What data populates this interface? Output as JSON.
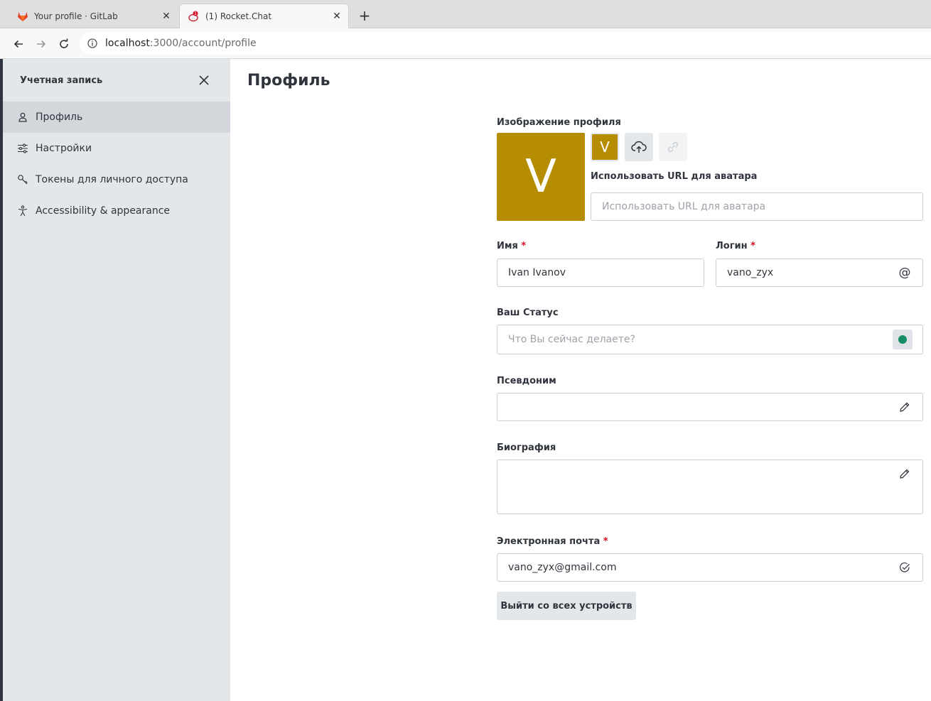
{
  "browser": {
    "tabs": [
      {
        "title": "Your profile · GitLab",
        "active": false,
        "icon": "gitlab-icon"
      },
      {
        "title": "(1) Rocket.Chat",
        "active": true,
        "icon": "rocketchat-icon",
        "badge": "1"
      }
    ],
    "url_host": "localhost",
    "url_path": ":3000/account/profile"
  },
  "sidebar": {
    "title": "Учетная запись",
    "items": [
      {
        "label": "Профиль",
        "icon": "user-icon",
        "active": true
      },
      {
        "label": "Настройки",
        "icon": "sliders-icon",
        "active": false
      },
      {
        "label": "Токены для личного доступа",
        "icon": "key-icon",
        "active": false
      },
      {
        "label": "Accessibility & appearance",
        "icon": "accessibility-icon",
        "active": false
      }
    ]
  },
  "main": {
    "title": "Профиль",
    "avatar": {
      "label": "Изображение профиля",
      "initial": "V",
      "url_label": "Использовать URL для аватара",
      "url_placeholder": "Использовать URL для аватара",
      "color": "#b68d00"
    },
    "name": {
      "label": "Имя",
      "required": "*",
      "value": "Ivan Ivanov"
    },
    "username": {
      "label": "Логин",
      "required": "*",
      "value": "vano_zyx"
    },
    "status": {
      "label": "Ваш Статус",
      "placeholder": "Что Вы сейчас делаете?",
      "color": "#158d65"
    },
    "nickname": {
      "label": "Псевдоним",
      "value": ""
    },
    "bio": {
      "label": "Биография",
      "value": ""
    },
    "email": {
      "label": "Электронная почта",
      "required": "*",
      "value": "vano_zyx@gmail.com"
    },
    "logout_label": "Выйти со всех устройств"
  }
}
